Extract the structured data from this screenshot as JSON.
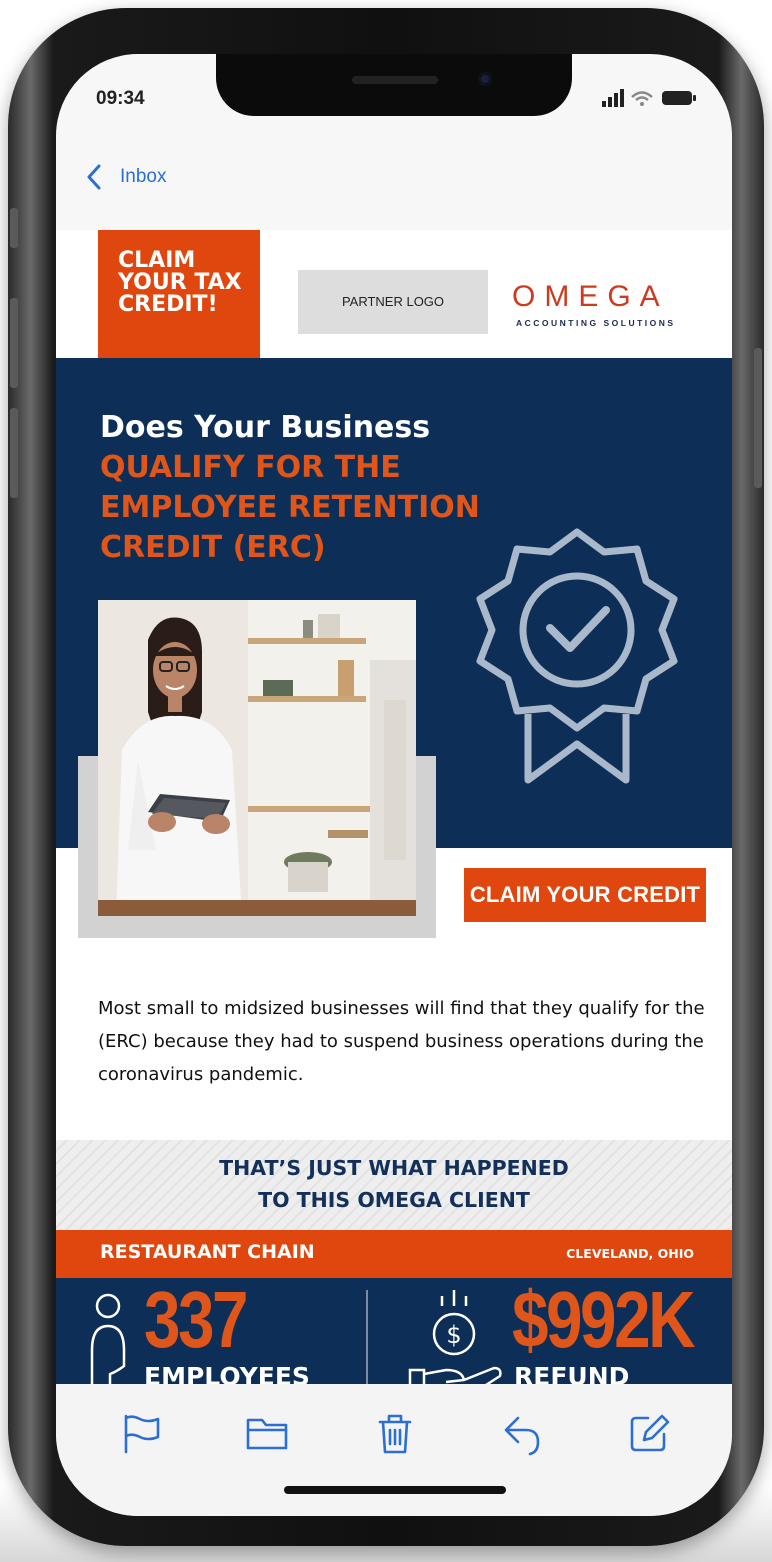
{
  "status_bar": {
    "time": "09:34"
  },
  "nav": {
    "back_label": "Inbox"
  },
  "email": {
    "claim_badge": "CLAIM YOUR TAX CREDIT!",
    "partner_logo": "PARTNER LOGO",
    "brand_name": "OMEGA",
    "brand_sub": "ACCOUNTING SOLUTIONS",
    "headline_white": "Does Your Business",
    "headline_orange": "QUALIFY FOR THE EMPLOYEE RETENTION CREDIT (ERC)",
    "cta_label": "CLAIM YOUR CREDIT",
    "body": "Most small to midsized businesses will find that they qualify for the (ERC) because they had to suspend business operations during the coronavirus pandemic.",
    "client_heading_line1": "THAT’S JUST WHAT HAPPENED",
    "client_heading_line2": "TO THIS OMEGA CLIENT",
    "client_type": "RESTAURANT CHAIN",
    "client_location": "CLEVELAND, OHIO",
    "stat_employees_value": "337",
    "stat_employees_label": "EMPLOYEES",
    "stat_refund_value": "$992K",
    "stat_refund_label": "REFUND"
  },
  "toolbar": {
    "icons": [
      "flag-icon",
      "folder-icon",
      "trash-icon",
      "reply-icon",
      "compose-icon"
    ]
  },
  "colors": {
    "navy": "#0d2f57",
    "orange": "#e0470f",
    "ios_blue": "#2a6fd1",
    "icon_outline": "#a9b8ca"
  }
}
